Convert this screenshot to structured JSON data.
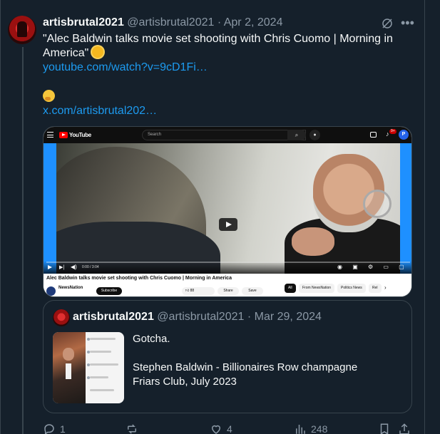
{
  "tweet": {
    "display_name": "artisbrutal2021",
    "handle": "@artisbrutal2021",
    "separator": "·",
    "date": "Apr 2, 2024",
    "text_line": "\"Alec Baldwin talks movie set shooting with Chris Cuomo | Morning in America\"",
    "link_youtube": "youtube.com/watch?v=9cD1Fi…",
    "link_x": "x.com/artisbrutal202…",
    "emoji_sun": "sun-with-face",
    "emoji_thinking": "thinking-face"
  },
  "embed": {
    "yt_brand": "YouTube",
    "search_placeholder": "Search",
    "notification_count": "9+",
    "profile_initial": "P",
    "time": "0:00 / 3:04",
    "video_title": "Alec Baldwin talks movie set shooting with Chris Cuomo | Morning in America",
    "channel": "NewsNation",
    "subscribe": "Subscribe",
    "likes": "88",
    "share": "Share",
    "save": "Save",
    "chips": [
      "All",
      "From NewsNation",
      "Politics News",
      "Rel"
    ]
  },
  "quote": {
    "display_name": "artisbrutal2021",
    "handle": "@artisbrutal2021",
    "separator": "·",
    "date": "Mar 29, 2024",
    "text_1": "Gotcha.",
    "text_2": "Stephen Baldwin - Billionaires Row champagne",
    "text_3": "Friars Club, July 2023"
  },
  "actions": {
    "replies": "1",
    "reposts": "",
    "likes": "4",
    "views": "248"
  },
  "colors": {
    "background": "#15202b",
    "link": "#1d9bf0",
    "muted": "#8b98a5",
    "border": "#38444d"
  }
}
